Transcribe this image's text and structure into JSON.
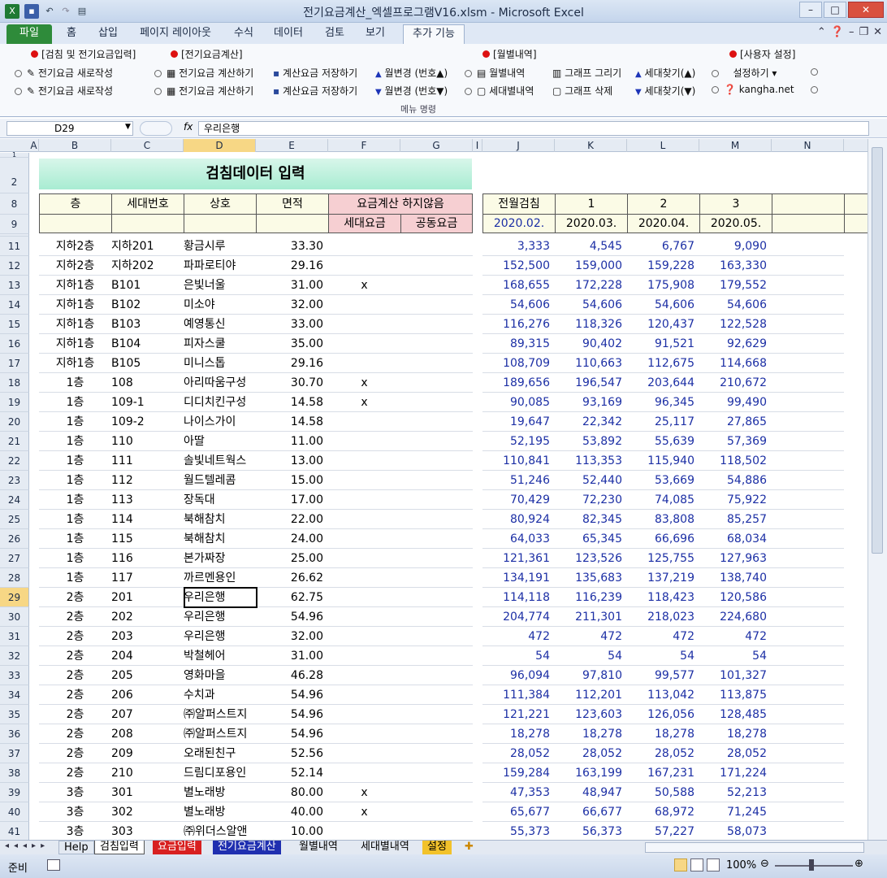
{
  "window": {
    "title": "전기요금계산_엑셀프로그램V16.xlsm  -  Microsoft Excel"
  },
  "tabs": [
    "파일",
    "홈",
    "삽입",
    "페이지 레이아웃",
    "수식",
    "데이터",
    "검토",
    "보기",
    "추가 기능"
  ],
  "ribbon": {
    "groups": {
      "g1": "[검침 및 전기요금입력]",
      "g2": "[전기요금계산]",
      "g3": "[월별내역]",
      "g4": "[사용자 설정]"
    },
    "b1a": "전기요금 새로작성",
    "b1b": "전기요금 새로작성",
    "b2a": "전기요금 계산하기",
    "b2b": "전기요금 계산하기",
    "b3a": "계산요금 저장하기",
    "b3b": "계산요금 저장하기",
    "b4a": "월변경 (번호▲)",
    "b4b": "월변경 (번호▼)",
    "b5a": "월별내역",
    "b5b": "세대별내역",
    "b6a": "그래프 그리기",
    "b6b": "그래프 삭제",
    "b7a": "세대찾기(▲)",
    "b7b": "세대찾기(▼)",
    "b8a": "설정하기 ▾",
    "b8b": "kangha.net",
    "group_label": "메뉴 명령"
  },
  "formula": {
    "namebox": "D29",
    "fx": "fx",
    "value": "우리은행"
  },
  "columns": [
    "A",
    "B",
    "C",
    "D",
    "E",
    "F",
    "G",
    "I",
    "J",
    "K",
    "L",
    "M",
    "N"
  ],
  "sheet": {
    "banner": "검침데이터 입력",
    "h_floor": "층",
    "h_unit": "세대번호",
    "h_name": "상호",
    "h_area": "면적",
    "h_nocalc": "요금계산 하지않음",
    "h_unitfee": "세대요금",
    "h_commonfee": "공동요금",
    "h_prev": "전월검침",
    "h_m1": "1",
    "h_m2": "2",
    "h_m3": "3",
    "d_prev": "2020.02.",
    "d_m1": "2020.03.",
    "d_m2": "2020.04.",
    "d_m3": "2020.05."
  },
  "rows": [
    {
      "r": "11",
      "f": "지하2층",
      "u": "지하201",
      "n": "황금시루",
      "a": "33.30",
      "x": "",
      "p": "3,333",
      "m1": "4,545",
      "m2": "6,767",
      "m3": "9,090"
    },
    {
      "r": "12",
      "f": "지하2층",
      "u": "지하202",
      "n": "파파로티야",
      "a": "29.16",
      "x": "",
      "p": "152,500",
      "m1": "159,000",
      "m2": "159,228",
      "m3": "163,330"
    },
    {
      "r": "13",
      "f": "지하1층",
      "u": "B101",
      "n": "은빛너울",
      "a": "31.00",
      "x": "x",
      "p": "168,655",
      "m1": "172,228",
      "m2": "175,908",
      "m3": "179,552"
    },
    {
      "r": "14",
      "f": "지하1층",
      "u": "B102",
      "n": "미소야",
      "a": "32.00",
      "x": "",
      "p": "54,606",
      "m1": "54,606",
      "m2": "54,606",
      "m3": "54,606"
    },
    {
      "r": "15",
      "f": "지하1층",
      "u": "B103",
      "n": "예영통신",
      "a": "33.00",
      "x": "",
      "p": "116,276",
      "m1": "118,326",
      "m2": "120,437",
      "m3": "122,528"
    },
    {
      "r": "16",
      "f": "지하1층",
      "u": "B104",
      "n": "피자스쿨",
      "a": "35.00",
      "x": "",
      "p": "89,315",
      "m1": "90,402",
      "m2": "91,521",
      "m3": "92,629"
    },
    {
      "r": "17",
      "f": "지하1층",
      "u": "B105",
      "n": "미니스톱",
      "a": "29.16",
      "x": "",
      "p": "108,709",
      "m1": "110,663",
      "m2": "112,675",
      "m3": "114,668"
    },
    {
      "r": "18",
      "f": "1층",
      "u": "108",
      "n": "아리따움구성",
      "a": "30.70",
      "x": "x",
      "p": "189,656",
      "m1": "196,547",
      "m2": "203,644",
      "m3": "210,672"
    },
    {
      "r": "19",
      "f": "1층",
      "u": "109-1",
      "n": "디디치킨구성",
      "a": "14.58",
      "x": "x",
      "p": "90,085",
      "m1": "93,169",
      "m2": "96,345",
      "m3": "99,490"
    },
    {
      "r": "20",
      "f": "1층",
      "u": "109-2",
      "n": "나이스가이",
      "a": "14.58",
      "x": "",
      "p": "19,647",
      "m1": "22,342",
      "m2": "25,117",
      "m3": "27,865"
    },
    {
      "r": "21",
      "f": "1층",
      "u": "110",
      "n": "아딸",
      "a": "11.00",
      "x": "",
      "p": "52,195",
      "m1": "53,892",
      "m2": "55,639",
      "m3": "57,369"
    },
    {
      "r": "22",
      "f": "1층",
      "u": "111",
      "n": "솔빛네트웍스",
      "a": "13.00",
      "x": "",
      "p": "110,841",
      "m1": "113,353",
      "m2": "115,940",
      "m3": "118,502"
    },
    {
      "r": "23",
      "f": "1층",
      "u": "112",
      "n": "월드텔레콤",
      "a": "15.00",
      "x": "",
      "p": "51,246",
      "m1": "52,440",
      "m2": "53,669",
      "m3": "54,886"
    },
    {
      "r": "24",
      "f": "1층",
      "u": "113",
      "n": "장독대",
      "a": "17.00",
      "x": "",
      "p": "70,429",
      "m1": "72,230",
      "m2": "74,085",
      "m3": "75,922"
    },
    {
      "r": "25",
      "f": "1층",
      "u": "114",
      "n": "북해참치",
      "a": "22.00",
      "x": "",
      "p": "80,924",
      "m1": "82,345",
      "m2": "83,808",
      "m3": "85,257"
    },
    {
      "r": "26",
      "f": "1층",
      "u": "115",
      "n": "북해참치",
      "a": "24.00",
      "x": "",
      "p": "64,033",
      "m1": "65,345",
      "m2": "66,696",
      "m3": "68,034"
    },
    {
      "r": "27",
      "f": "1층",
      "u": "116",
      "n": "본가짜장",
      "a": "25.00",
      "x": "",
      "p": "121,361",
      "m1": "123,526",
      "m2": "125,755",
      "m3": "127,963"
    },
    {
      "r": "28",
      "f": "1층",
      "u": "117",
      "n": "까르멘용인",
      "a": "26.62",
      "x": "",
      "p": "134,191",
      "m1": "135,683",
      "m2": "137,219",
      "m3": "138,740"
    },
    {
      "r": "29",
      "f": "2층",
      "u": "201",
      "n": "우리은행",
      "a": "62.75",
      "x": "",
      "p": "114,118",
      "m1": "116,239",
      "m2": "118,423",
      "m3": "120,586"
    },
    {
      "r": "30",
      "f": "2층",
      "u": "202",
      "n": "우리은행",
      "a": "54.96",
      "x": "",
      "p": "204,774",
      "m1": "211,301",
      "m2": "218,023",
      "m3": "224,680"
    },
    {
      "r": "31",
      "f": "2층",
      "u": "203",
      "n": "우리은행",
      "a": "32.00",
      "x": "",
      "p": "472",
      "m1": "472",
      "m2": "472",
      "m3": "472"
    },
    {
      "r": "32",
      "f": "2층",
      "u": "204",
      "n": "박철헤어",
      "a": "31.00",
      "x": "",
      "p": "54",
      "m1": "54",
      "m2": "54",
      "m3": "54"
    },
    {
      "r": "33",
      "f": "2층",
      "u": "205",
      "n": "영화마을",
      "a": "46.28",
      "x": "",
      "p": "96,094",
      "m1": "97,810",
      "m2": "99,577",
      "m3": "101,327"
    },
    {
      "r": "34",
      "f": "2층",
      "u": "206",
      "n": "수치과",
      "a": "54.96",
      "x": "",
      "p": "111,384",
      "m1": "112,201",
      "m2": "113,042",
      "m3": "113,875"
    },
    {
      "r": "35",
      "f": "2층",
      "u": "207",
      "n": "㈜알퍼스트지",
      "a": "54.96",
      "x": "",
      "p": "121,221",
      "m1": "123,603",
      "m2": "126,056",
      "m3": "128,485"
    },
    {
      "r": "36",
      "f": "2층",
      "u": "208",
      "n": "㈜알퍼스트지",
      "a": "54.96",
      "x": "",
      "p": "18,278",
      "m1": "18,278",
      "m2": "18,278",
      "m3": "18,278"
    },
    {
      "r": "37",
      "f": "2층",
      "u": "209",
      "n": "오래된친구",
      "a": "52.56",
      "x": "",
      "p": "28,052",
      "m1": "28,052",
      "m2": "28,052",
      "m3": "28,052"
    },
    {
      "r": "38",
      "f": "2층",
      "u": "210",
      "n": "드림디포용인",
      "a": "52.14",
      "x": "",
      "p": "159,284",
      "m1": "163,199",
      "m2": "167,231",
      "m3": "171,224"
    },
    {
      "r": "39",
      "f": "3층",
      "u": "301",
      "n": "별노래방",
      "a": "80.00",
      "x": "x",
      "p": "47,353",
      "m1": "48,947",
      "m2": "50,588",
      "m3": "52,213"
    },
    {
      "r": "40",
      "f": "3층",
      "u": "302",
      "n": "별노래방",
      "a": "40.00",
      "x": "x",
      "p": "65,677",
      "m1": "66,677",
      "m2": "68,972",
      "m3": "71,245"
    },
    {
      "r": "41",
      "f": "3층",
      "u": "303",
      "n": "㈜위더스알앤",
      "a": "10.00",
      "x": "",
      "p": "55,373",
      "m1": "56,373",
      "m2": "57,227",
      "m3": "58,073"
    }
  ],
  "rowheaders": {
    "r1": "1",
    "r2": "2",
    "r8": "8",
    "r9": "9"
  },
  "sheettabs": [
    "Help",
    "검침입력",
    "요금입력",
    "전기요금계산",
    "월별내역",
    "세대별내역",
    "설정"
  ],
  "status": {
    "ready": "준비",
    "zoom": "100%"
  }
}
